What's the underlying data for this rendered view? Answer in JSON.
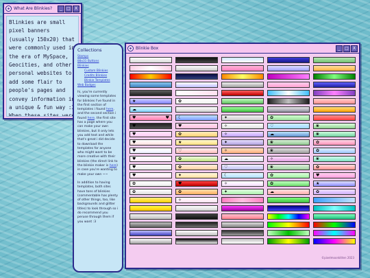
{
  "what_window": {
    "title": "What Are Blinkies?",
    "min": "_",
    "max": "□",
    "close": "X",
    "text": "Blinkies are small pixel banners (usually 150x20) that were commonly used in the era of MySpace, Geocities, and other personal websites to add some flair to people's pages and convey information in a unique & fun way :3 When these sites were no longer around, blinkies fell out of use as personal & customizable sites became less and less popular. What"
  },
  "collections": {
    "title": "Collections",
    "links": [
      {
        "label": "Stamps",
        "sub": false
      },
      {
        "label": "88x31 Buttons",
        "sub": false
      },
      {
        "label": "Blinkies",
        "sub": false
      },
      {
        "label": "Custom Blinkies",
        "sub": true
      },
      {
        "label": "Credits Blinkies",
        "sub": true
      },
      {
        "label": "Blinkie Templates",
        "sub": true
      },
      {
        "label": "Web Badges",
        "sub": false
      }
    ],
    "para1_pre": "hi, you're currently viewing some templates for blinkies I've found in the first section of templates i found ",
    "para1_link1": "here",
    "para1_mid": ", and the second section i found ",
    "para1_link2": "here",
    "para1_post": ". the first site has a page where you can make your own blinkies, but it only lets you add text and while that's great i did decide to download the templates for anyone who might want to be more creative with their blinkies (the direct link to the blinkie maker is ",
    "para1_link3": "here",
    "para1_end": ") in case you're wanting to make your own ~~",
    "para2": "In addition to having templates, both sites have tons of blinkies (commentable has plenty of other things, too, like backgrounds and glitter titles) to look through so i do recommend you peruse through them if you want :3"
  },
  "box_window": {
    "title": "Blinkie Box",
    "min": "_",
    "max": "□",
    "close": "X",
    "credit": "©pixelmoonkitten 2023"
  },
  "blinkies": [
    {
      "bg": "linear-gradient(#ffffff,#d8d8d8)",
      "deco": "",
      "deco2": ""
    },
    {
      "bg": "linear-gradient(#111,#444)",
      "deco": "",
      "deco2": ""
    },
    {
      "bg": "linear-gradient(#cfe8ff,#ffffff)",
      "deco": "",
      "deco2": ""
    },
    {
      "bg": "linear-gradient(#3b3bd8,#1a1a8a)",
      "deco": "",
      "deco2": ""
    },
    {
      "bg": "linear-gradient(#b6e8b6,#70c070)",
      "deco": "",
      "deco2": ""
    },
    {
      "bg": "linear-gradient(90deg,#ffd0e8,#ffffff,#ffd0e8)",
      "deco": "",
      "deco2": ""
    },
    {
      "bg": "linear-gradient(#fff,#ccc)",
      "deco": "",
      "deco2": ""
    },
    {
      "bg": "linear-gradient(#ffb6d9,#ff80c0)",
      "deco": "",
      "deco2": ""
    },
    {
      "bg": "linear-gradient(#e0e0ff,#a0a0ff)",
      "deco": "",
      "deco2": ""
    },
    {
      "bg": "linear-gradient(#ffe0a0,#ffb040)",
      "deco": "",
      "deco2": ""
    },
    {
      "bg": "linear-gradient(90deg,#ff0000,#ffcc00,#ff0000)",
      "deco": "",
      "deco2": ""
    },
    {
      "bg": "linear-gradient(#0a0a40,#304080)",
      "deco": "",
      "deco2": ""
    },
    {
      "bg": "linear-gradient(90deg,#ff8800,#ffff66,#ff8800)",
      "deco": "",
      "deco2": ""
    },
    {
      "bg": "linear-gradient(90deg,#c000c0,#ff80ff)",
      "deco": "",
      "deco2": ""
    },
    {
      "bg": "linear-gradient(90deg,#008000,#80ff80,#008000)",
      "deco": "",
      "deco2": ""
    },
    {
      "bg": "linear-gradient(#88c8f0,#4080c0)",
      "deco": "",
      "deco2": ""
    },
    {
      "bg": "linear-gradient(#ffffff,#c0c0ff)",
      "deco": "",
      "deco2": ""
    },
    {
      "bg": "linear-gradient(#f0f0f0,#a0a0a0)",
      "deco": "",
      "deco2": ""
    },
    {
      "bg": "linear-gradient(#ffd0f0,#ffa0d0)",
      "deco": "",
      "deco2": ""
    },
    {
      "bg": "linear-gradient(#6060ff,#2020a0)",
      "deco": "",
      "deco2": ""
    },
    {
      "bg": "linear-gradient(#606060,#202020)",
      "deco": "",
      "deco2": ""
    },
    {
      "bg": "linear-gradient(90deg,#ffffff,#ffe0f0)",
      "deco": "",
      "deco2": ""
    },
    {
      "bg": "linear-gradient(#ff6060,#c00000)",
      "deco": "",
      "deco2": ""
    },
    {
      "bg": "linear-gradient(90deg,#40c0ff,#ffffff,#40c0ff)",
      "deco": "",
      "deco2": ""
    },
    {
      "bg": "linear-gradient(90deg,#8040c0,#ff80ff,#8040c0)",
      "deco": "",
      "deco2": ""
    },
    {
      "bg": "linear-gradient(#d0d0ff,#8080ff)",
      "deco": "★",
      "deco2": ""
    },
    {
      "bg": "linear-gradient(#ffffff,#f0f0f0)",
      "deco": "✿",
      "deco2": ""
    },
    {
      "bg": "linear-gradient(#c0ffc0,#60c060)",
      "deco": "",
      "deco2": ""
    },
    {
      "bg": "linear-gradient(90deg,#202020,#c0c0c0,#202020)",
      "deco": "",
      "deco2": ""
    },
    {
      "bg": "linear-gradient(#ffd0d0,#ff9090)",
      "deco": "",
      "deco2": ""
    },
    {
      "bg": "linear-gradient(#e0ffff,#80d0ff)",
      "deco": "☁",
      "deco2": ""
    },
    {
      "bg": "linear-gradient(#ffffff,#d0d0d0)",
      "deco": "",
      "deco2": ""
    },
    {
      "bg": "linear-gradient(#a0ffa0,#40c040)",
      "deco": "",
      "deco2": ""
    },
    {
      "bg": "linear-gradient(#e8e8e8,#9090a0)",
      "deco": "",
      "deco2": ""
    },
    {
      "bg": "linear-gradient(#ffe080,#ffa000)",
      "deco": "",
      "deco2": ""
    },
    {
      "bg": "linear-gradient(#ffc0e0,#ff80b0)",
      "deco": "♥",
      "deco2": "♥"
    },
    {
      "bg": "linear-gradient(#c0e0ff,#80a0ff)",
      "deco": "☾",
      "deco2": ""
    },
    {
      "bg": "linear-gradient(#f0f0f0,#d0d0d0)",
      "deco": "✦",
      "deco2": ""
    },
    {
      "bg": "linear-gradient(#d0ffd0,#a0e0a0)",
      "deco": "✿",
      "deco2": ""
    },
    {
      "bg": "linear-gradient(#ff9090,#ff4040)",
      "deco": "",
      "deco2": ""
    },
    {
      "bg": "linear-gradient(#202020,#505050)",
      "deco": "♥",
      "deco2": ""
    },
    {
      "bg": "linear-gradient(#ffe0f0,#ffc0e0)",
      "deco": "♥",
      "deco2": ""
    },
    {
      "bg": "linear-gradient(#ffffff,#e0e0e0)",
      "deco": "✧",
      "deco2": ""
    },
    {
      "bg": "linear-gradient(#d0f0ff,#a0d8ff)",
      "deco": "♡",
      "deco2": ""
    },
    {
      "bg": "linear-gradient(#e0ffe0,#90d090)",
      "deco": "❀",
      "deco2": ""
    },
    {
      "bg": "linear-gradient(#ffe8ff,#ffc8f0)",
      "deco": "♥",
      "deco2": ""
    },
    {
      "bg": "linear-gradient(#fff0c0,#ffd070)",
      "deco": "✿",
      "deco2": ""
    },
    {
      "bg": "linear-gradient(#f0e0ff,#c0a0ff)",
      "deco": "✧",
      "deco2": ""
    },
    {
      "bg": "linear-gradient(#c0e8ff,#6090d0)",
      "deco": "☁",
      "deco2": ""
    },
    {
      "bg": "linear-gradient(#d0ffe0,#70d0a0)",
      "deco": "❀",
      "deco2": ""
    },
    {
      "bg": "linear-gradient(#ffffff,#ffe0e0)",
      "deco": "♥",
      "deco2": ""
    },
    {
      "bg": "linear-gradient(#fff8d0,#ffe080)",
      "deco": "★",
      "deco2": ""
    },
    {
      "bg": "linear-gradient(#e8e0ff,#b0a0e0)",
      "deco": "✦",
      "deco2": ""
    },
    {
      "bg": "linear-gradient(#d8f0d8,#90c890)",
      "deco": "❀",
      "deco2": ""
    },
    {
      "bg": "linear-gradient(#ffd8e8,#ff90b8)",
      "deco": "✿",
      "deco2": ""
    },
    {
      "bg": "linear-gradient(#ffffff,#f0f0ff)",
      "deco": "♥",
      "deco2": ""
    },
    {
      "bg": "linear-gradient(#fff0f0,#ffc0c0)",
      "deco": "♡",
      "deco2": ""
    },
    {
      "bg": "linear-gradient(#ffe0c0,#ffb080)",
      "deco": "✧",
      "deco2": ""
    },
    {
      "bg": "linear-gradient(#e0e0e0,#a0a0a0)",
      "deco": "❀",
      "deco2": ""
    },
    {
      "bg": "linear-gradient(#e0f0ff,#a0c8ff)",
      "deco": "✿",
      "deco2": ""
    },
    {
      "bg": "linear-gradient(#ffffff,#ffe8f8)",
      "deco": "♥",
      "deco2": ""
    },
    {
      "bg": "linear-gradient(#f0ffe0,#c0e080)",
      "deco": "✿",
      "deco2": ""
    },
    {
      "bg": "linear-gradient(#ffffff,#e0e0f0)",
      "deco": "☁",
      "deco2": ""
    },
    {
      "bg": "linear-gradient(#ffe0ff,#e0a0e0)",
      "deco": "✧",
      "deco2": ""
    },
    {
      "bg": "linear-gradient(#d0fff0,#80e0c0)",
      "deco": "❀",
      "deco2": ""
    },
    {
      "bg": "linear-gradient(#ffffff,#e8e8e8)",
      "deco": "♥",
      "deco2": ""
    },
    {
      "bg": "linear-gradient(#fff0e0,#ffd0a0)",
      "deco": "✿",
      "deco2": ""
    },
    {
      "bg": "linear-gradient(#f0f0ff,#c0c0f0)",
      "deco": "♡",
      "deco2": ""
    },
    {
      "bg": "linear-gradient(#e0f0e0,#a0d0a0)",
      "deco": "❀",
      "deco2": ""
    },
    {
      "bg": "linear-gradient(#ffe0e0,#ff9090)",
      "deco": "✿",
      "deco2": ""
    },
    {
      "bg": "linear-gradient(#ffffff,#ffe0f0)",
      "deco": "♥",
      "deco2": ""
    },
    {
      "bg": "linear-gradient(#fff8e0,#ffe0a0)",
      "deco": "✦",
      "deco2": ""
    },
    {
      "bg": "linear-gradient(#e8f8ff,#b0e0ff)",
      "deco": "☾",
      "deco2": ""
    },
    {
      "bg": "linear-gradient(#e0ffe0,#a0f0a0)",
      "deco": "✿",
      "deco2": ""
    },
    {
      "bg": "linear-gradient(#ffd0f0,#ffa0e0)",
      "deco": "♥",
      "deco2": ""
    },
    {
      "bg": "linear-gradient(#ffffff,#f0f0f0)",
      "deco": "✿",
      "deco2": ""
    },
    {
      "bg": "linear-gradient(#ff4040,#c00000)",
      "deco": "♥",
      "deco2": ""
    },
    {
      "bg": "linear-gradient(#ffffff,#f8e0ff)",
      "deco": "✧",
      "deco2": ""
    },
    {
      "bg": "linear-gradient(#c0ffc0,#70e070)",
      "deco": "✿",
      "deco2": ""
    },
    {
      "bg": "linear-gradient(#e0e0ff,#9090ff)",
      "deco": "★",
      "deco2": ""
    },
    {
      "bg": "linear-gradient(#ffffff,#e0e0e0)",
      "deco": "✿",
      "deco2": ""
    },
    {
      "bg": "linear-gradient(#ffe0b0,#ffb060)",
      "deco": "✿",
      "deco2": ""
    },
    {
      "bg": "linear-gradient(#e0ffe0,#b0f0b0)",
      "deco": "✦",
      "deco2": ""
    },
    {
      "bg": "linear-gradient(#ffe0e0,#ffb0b0)",
      "deco": "☁",
      "deco2": ""
    },
    {
      "bg": "linear-gradient(#f0e0ff,#d0b0ff)",
      "deco": "✿",
      "deco2": ""
    },
    {
      "bg": "linear-gradient(#fff080,#ffd000)",
      "deco": "",
      "deco2": ""
    },
    {
      "bg": "linear-gradient(#ffffff,#ffe0f0)",
      "deco": "✧",
      "deco2": ""
    },
    {
      "bg": "linear-gradient(90deg,#ff80c0,#ffc0e0,#ff80c0)",
      "deco": "",
      "deco2": ""
    },
    {
      "bg": "linear-gradient(#80ff80,#40c040)",
      "deco": "",
      "deco2": ""
    },
    {
      "bg": "linear-gradient(90deg,#40a0ff,#c0e0ff)",
      "deco": "",
      "deco2": ""
    },
    {
      "bg": "linear-gradient(#ffff40,#ffc000)",
      "deco": "",
      "deco2": ""
    },
    {
      "bg": "linear-gradient(#ffffff,#d0d0d0)",
      "deco": "",
      "deco2": ""
    },
    {
      "bg": "linear-gradient(#ff40ff,#a000a0)",
      "deco": "",
      "deco2": ""
    },
    {
      "bg": "linear-gradient(#000080,#4040ff)",
      "deco": "",
      "deco2": ""
    },
    {
      "bg": "linear-gradient(90deg,#00c0c0,#80ffff,#00c0c0)",
      "deco": "",
      "deco2": ""
    },
    {
      "bg": "linear-gradient(#f0f0f0,#c0c0c0)",
      "deco": "",
      "deco2": ""
    },
    {
      "bg": "linear-gradient(#404040,#101010)",
      "deco": "",
      "deco2": ""
    },
    {
      "bg": "linear-gradient(#ffc0d0,#ff8090)",
      "deco": "",
      "deco2": ""
    },
    {
      "bg": "linear-gradient(90deg,#ffff00,#00ff00,#00ffff,#0000ff,#ff00ff)",
      "deco": "",
      "deco2": ""
    },
    {
      "bg": "linear-gradient(#80ffc0,#20c080)",
      "deco": "",
      "deco2": ""
    },
    {
      "bg": "linear-gradient(#c0c0c0,#606060)",
      "deco": "",
      "deco2": ""
    },
    {
      "bg": "linear-gradient(#202020,#707070)",
      "deco": "",
      "deco2": ""
    },
    {
      "bg": "linear-gradient(#e0e0e0,#808080)",
      "deco": "",
      "deco2": ""
    },
    {
      "bg": "linear-gradient(90deg,#00ff00,#ffff00,#ff0000)",
      "deco": "",
      "deco2": ""
    },
    {
      "bg": "linear-gradient(90deg,#ff0000,#00ff00,#0000ff)",
      "deco": "",
      "deco2": ""
    },
    {
      "bg": "linear-gradient(#c0c0ff,#4040c0)",
      "deco": "",
      "deco2": ""
    },
    {
      "bg": "linear-gradient(#ffffff,#c0c0c0)",
      "deco": "",
      "deco2": ""
    },
    {
      "bg": "linear-gradient(#303030,#a0a0a0)",
      "deco": "",
      "deco2": ""
    },
    {
      "bg": "linear-gradient(90deg,#c0ffc0,#00c000,#c0ffc0)",
      "deco": "",
      "deco2": ""
    },
    {
      "bg": "linear-gradient(90deg,#ff00ff,#00ffff,#ff00ff)",
      "deco": "",
      "deco2": ""
    },
    {
      "bg": "linear-gradient(#ffffff,#a0a0a0)",
      "deco": "",
      "deco2": ""
    },
    {
      "bg": "linear-gradient(#000000,#ffffff)",
      "deco": "",
      "deco2": ""
    },
    {
      "bg": "linear-gradient(#c0c0c0,#ffffff)",
      "deco": "",
      "deco2": ""
    },
    {
      "bg": "linear-gradient(90deg,#00a000,#ffff00,#00a000)",
      "deco": "",
      "deco2": ""
    },
    {
      "bg": "linear-gradient(90deg,#0000ff,#ff00ff,#ffff00)",
      "deco": "",
      "deco2": ""
    }
  ]
}
